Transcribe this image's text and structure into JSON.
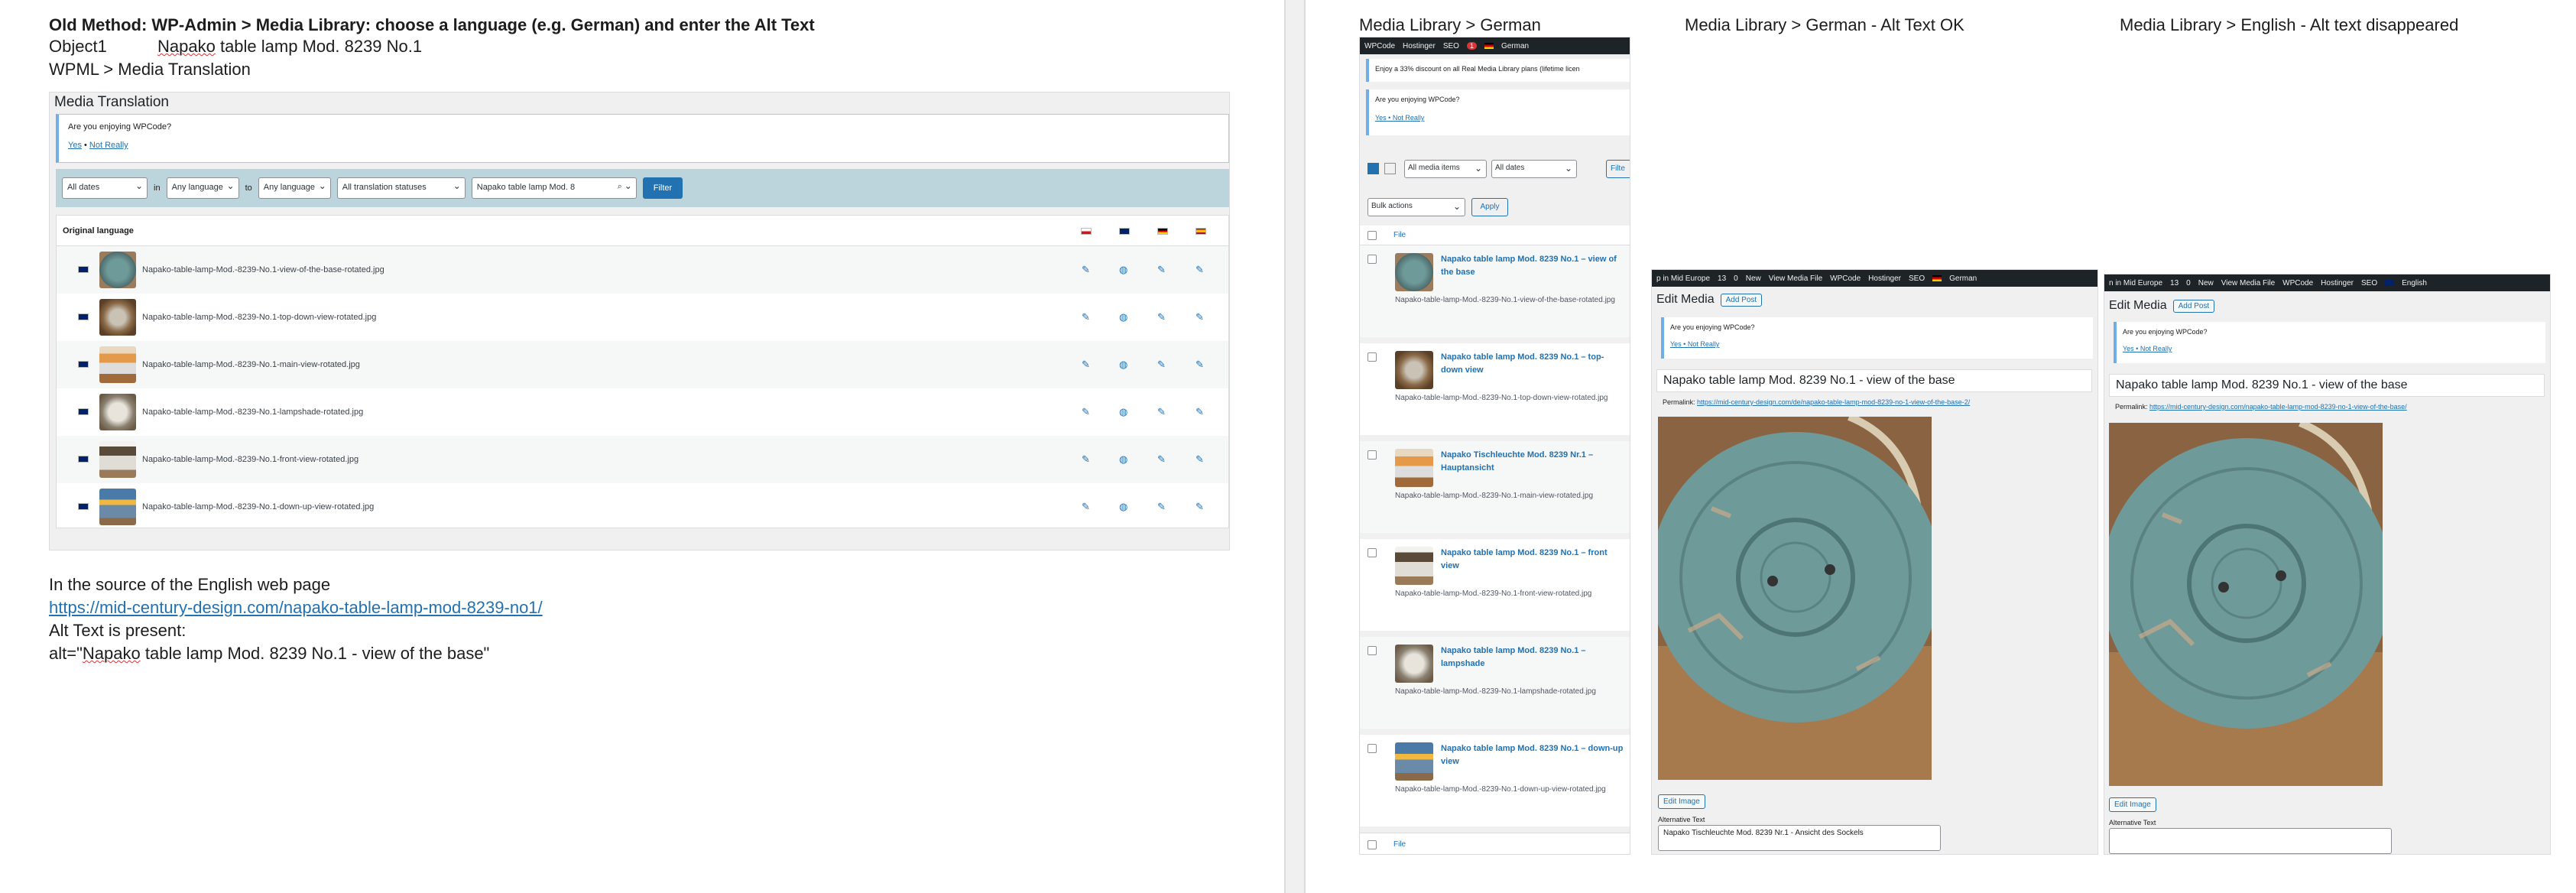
{
  "left": {
    "heading": "Old Method: WP-Admin > Media Library: choose a language (e.g. German) and enter the Alt Text",
    "object_label": "Object1",
    "object_value_word": "Napako",
    "object_value_rest": " table lamp Mod. 8239 No.1",
    "wpml_path": "WPML > Media Translation",
    "panel": {
      "title": "Media Translation",
      "notice_text": "Are you enjoying WPCode?",
      "notice_yes": "Yes",
      "notice_sep": " • ",
      "notice_no": "Not Really",
      "filters": {
        "dates": "All dates",
        "in_label": "in",
        "from_lang": "Any language",
        "to_label": "to",
        "to_lang": "Any language",
        "status": "All translation statuses",
        "search_value": "Napako table lamp Mod. 8",
        "filter_btn": "Filter"
      },
      "table_header": "Original language",
      "rows": [
        {
          "file": "Napako-table-lamp-Mod.-8239-No.1-view-of-the-base-rotated.jpg"
        },
        {
          "file": "Napako-table-lamp-Mod.-8239-No.1-top-down-view-rotated.jpg"
        },
        {
          "file": "Napako-table-lamp-Mod.-8239-No.1-main-view-rotated.jpg"
        },
        {
          "file": "Napako-table-lamp-Mod.-8239-No.1-lampshade-rotated.jpg"
        },
        {
          "file": "Napako-table-lamp-Mod.-8239-No.1-front-view-rotated.jpg"
        },
        {
          "file": "Napako-table-lamp-Mod.-8239-No.1-down-up-view-rotated.jpg"
        }
      ]
    },
    "source_note": "In the source of the English web page",
    "source_url": "https://mid-century-design.com/napako-table-lamp-mod-8239-no1/",
    "alt_present": "Alt Text is present:",
    "alt_prefix": "alt=\"",
    "alt_word": "Napako",
    "alt_rest": " table lamp Mod. 8239 No.1 - view of the base\""
  },
  "right": {
    "caption_ml_german": "Media Library > German",
    "caption_german_ok": "Media Library > German - Alt Text OK",
    "caption_english": "Media Library > English - Alt text disappeared",
    "ml_admin_bar": [
      "WPCode",
      "Hostinger",
      "SEO",
      "German"
    ],
    "ml_notice_discount": "Enjoy a 33% discount on all Real Media Library plans (lifetime licen",
    "ml_notice_enjoy": "Are you enjoying WPCode?",
    "ml_notice_links": "Yes • Not Really",
    "ml_filter_items": "All media items",
    "ml_filter_dates": "All dates",
    "ml_filter_btn": "Filte",
    "ml_bulk": "Bulk actions",
    "ml_apply": "Apply",
    "ml_file_header": "File",
    "ml_items": [
      {
        "title": "Napako table lamp Mod. 8239 No.1 – view of the base",
        "file": "Napako-table-lamp-Mod.-8239-No.1-view-of-the-base-rotated.jpg"
      },
      {
        "title": "Napako table lamp Mod. 8239 No.1 – top-down view",
        "file": "Napako-table-lamp-Mod.-8239-No.1-top-down-view-rotated.jpg"
      },
      {
        "title": "Napako Tischleuchte Mod. 8239 Nr.1 – Hauptansicht",
        "file": "Napako-table-lamp-Mod.-8239-No.1-main-view-rotated.jpg"
      },
      {
        "title": "Napako table lamp Mod. 8239 No.1 – front view",
        "file": "Napako-table-lamp-Mod.-8239-No.1-front-view-rotated.jpg"
      },
      {
        "title": "Napako table lamp Mod. 8239 No.1 – lampshade",
        "file": "Napako-table-lamp-Mod.-8239-No.1-lampshade-rotated.jpg"
      },
      {
        "title": "Napako table lamp Mod. 8239 No.1 – down-up view",
        "file": "Napako-table-lamp-Mod.-8239-No.1-down-up-view-rotated.jpg"
      }
    ],
    "ml_footer_file": "File",
    "edit_admin_bar_de": [
      "p in Mid Europe",
      "13",
      "0",
      "New",
      "View Media File",
      "WPCode",
      "Hostinger",
      "SEO",
      "German"
    ],
    "edit_admin_bar_en": [
      "n in Mid Europe",
      "13",
      "0",
      "New",
      "View Media File",
      "WPCode",
      "Hostinger",
      "SEO",
      "English"
    ],
    "edit_title": "Edit Media",
    "add_post": "Add Post",
    "edit_notice": "Are you enjoying WPCode?",
    "edit_notice_links": "Yes • Not Really",
    "media_title": "Napako table lamp Mod. 8239 No.1 - view of the base",
    "permalink_label": "Permalink:",
    "permalink_de": "https://mid-century-design.com/de/napako-table-lamp-mod-8239-no-1-view-of-the-base-2/",
    "permalink_en": "https://mid-century-design.com/napako-table-lamp-mod-8239-no-1-view-of-the-base/",
    "edit_image_btn": "Edit Image",
    "alt_label": "Alternative Text",
    "alt_value_de": "Napako Tischleuchte Mod. 8239 Nr.1 - Ansicht des Sockels",
    "alt_value_en": ""
  },
  "colors": {
    "link": "#2271b1",
    "adminbar": "#1d2327",
    "filterbar": "#bcd5dc",
    "lamp_base": "#6f9a9a"
  }
}
